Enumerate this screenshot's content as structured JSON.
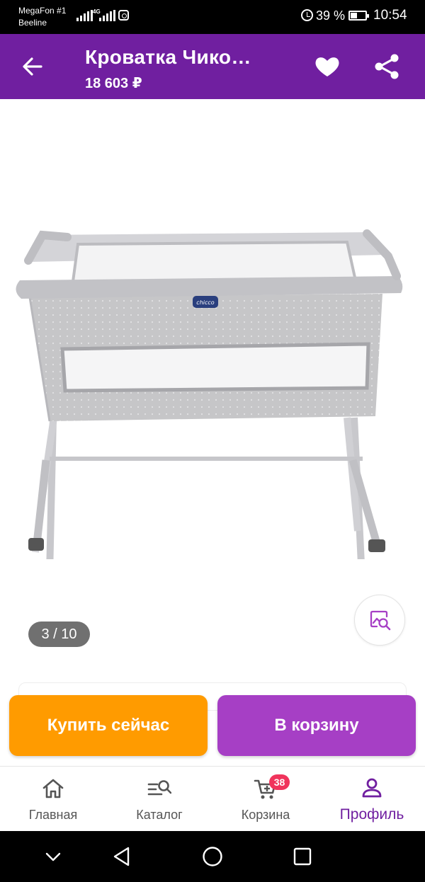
{
  "status_bar": {
    "carrier_1": "MegaFon #1",
    "carrier_2": "Beeline",
    "network": "4G",
    "battery_percent": "39 %",
    "time": "10:54"
  },
  "app_bar": {
    "title": "Кроватка Чико…",
    "price": "18 603 ₽"
  },
  "gallery": {
    "counter": "3 / 10",
    "brand_label": "chicco"
  },
  "actions": {
    "buy_now": "Купить сейчас",
    "add_to_cart": "В корзину"
  },
  "bottom_nav": {
    "items": [
      {
        "label": "Главная",
        "icon": "home-icon"
      },
      {
        "label": "Каталог",
        "icon": "catalog-search-icon"
      },
      {
        "label": "Корзина",
        "icon": "cart-icon",
        "badge": "38"
      },
      {
        "label": "Профиль",
        "icon": "profile-icon",
        "active": true
      }
    ]
  },
  "colors": {
    "brand_purple": "#701fa0",
    "buy_orange": "#ff9b00",
    "cart_purple": "#a63fc5",
    "badge_red": "#f0345c"
  }
}
